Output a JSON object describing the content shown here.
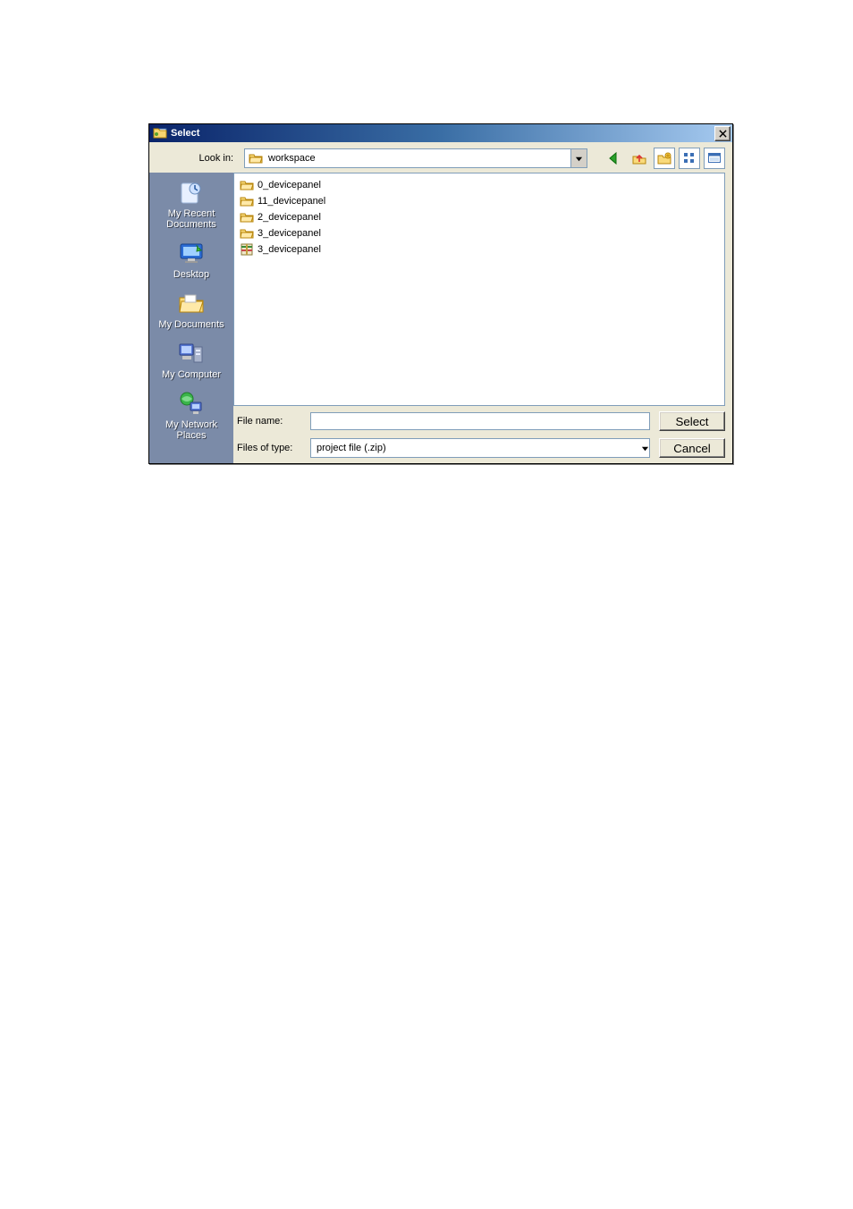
{
  "window": {
    "title": "Select"
  },
  "lookin": {
    "label": "Look in:",
    "value": "workspace"
  },
  "toolbar_icons": [
    "back-icon",
    "up-one-level-icon",
    "new-folder-icon",
    "view-menu-icon",
    "preview-icon"
  ],
  "sidebar": {
    "items": [
      {
        "label": "My Recent Documents"
      },
      {
        "label": "Desktop"
      },
      {
        "label": "My Documents"
      },
      {
        "label": "My Computer"
      },
      {
        "label": "My Network Places"
      }
    ]
  },
  "files": [
    {
      "name": "0_devicepanel",
      "type": "folder"
    },
    {
      "name": "11_devicepanel",
      "type": "folder"
    },
    {
      "name": "2_devicepanel",
      "type": "folder"
    },
    {
      "name": "3_devicepanel",
      "type": "folder"
    },
    {
      "name": "3_devicepanel",
      "type": "file"
    }
  ],
  "bottom": {
    "filename_label": "File name:",
    "filename_value": "",
    "filetype_label": "Files of type:",
    "filetype_value": "project file (.zip)",
    "select_label": "Select",
    "cancel_label": "Cancel"
  }
}
